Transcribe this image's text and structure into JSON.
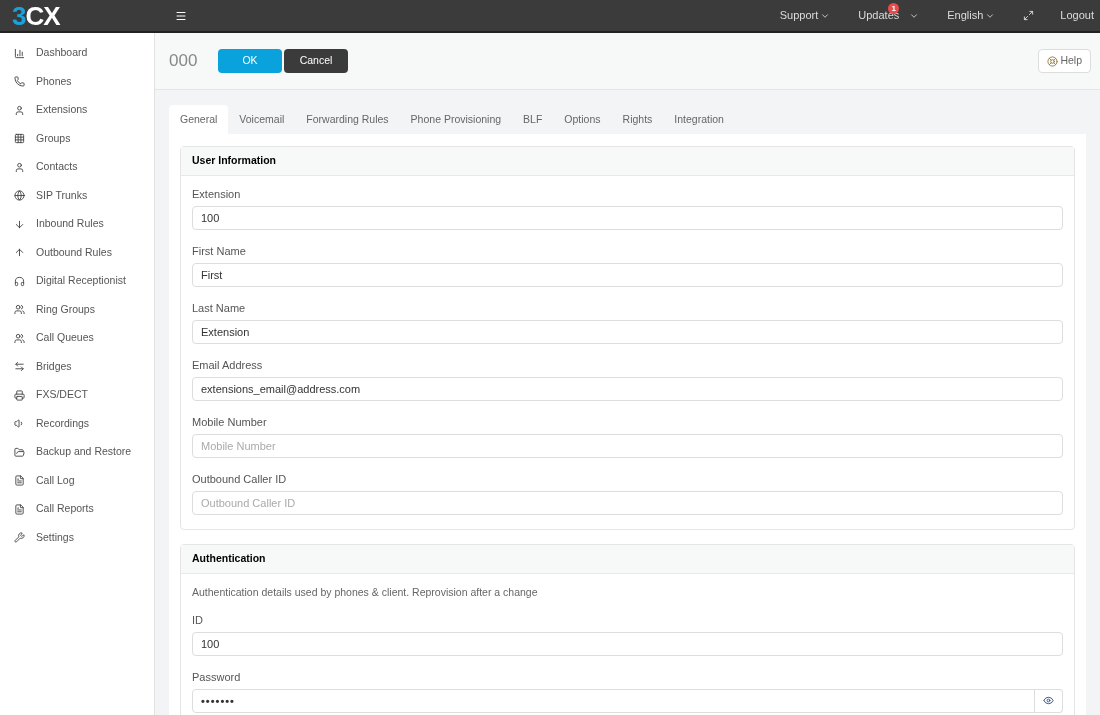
{
  "topbar": {
    "logo": {
      "accent": "3",
      "rest": "CX"
    },
    "menu": [
      {
        "label": "Support"
      },
      {
        "label": "Updates",
        "badge": "1"
      },
      {
        "label": "English"
      }
    ],
    "logout": "Logout"
  },
  "sidebar": {
    "items": [
      {
        "label": "Dashboard"
      },
      {
        "label": "Phones"
      },
      {
        "label": "Extensions"
      },
      {
        "label": "Groups"
      },
      {
        "label": "Contacts"
      },
      {
        "label": "SIP Trunks"
      },
      {
        "label": "Inbound Rules"
      },
      {
        "label": "Outbound Rules"
      },
      {
        "label": "Digital Receptionist"
      },
      {
        "label": "Ring Groups"
      },
      {
        "label": "Call Queues"
      },
      {
        "label": "Bridges"
      },
      {
        "label": "FXS/DECT"
      },
      {
        "label": "Recordings"
      },
      {
        "label": "Backup and Restore"
      },
      {
        "label": "Call Log"
      },
      {
        "label": "Call Reports"
      },
      {
        "label": "Settings"
      }
    ]
  },
  "header": {
    "title": "000",
    "ok": "OK",
    "cancel": "Cancel",
    "help": "Help"
  },
  "tabs": [
    {
      "label": "General",
      "selected": true
    },
    {
      "label": "Voicemail",
      "selected": false
    },
    {
      "label": "Forwarding Rules",
      "selected": false
    },
    {
      "label": "Phone Provisioning",
      "selected": false
    },
    {
      "label": "BLF",
      "selected": false
    },
    {
      "label": "Options",
      "selected": false
    },
    {
      "label": "Rights",
      "selected": false
    },
    {
      "label": "Integration",
      "selected": false
    }
  ],
  "sections": [
    {
      "title": "User Information",
      "fields": [
        {
          "label": "Extension",
          "value": "100"
        },
        {
          "label": "First Name",
          "value": "First"
        },
        {
          "label": "Last Name",
          "value": "Extension"
        },
        {
          "label": "Email Address",
          "value": "extensions_email@address.com"
        },
        {
          "label": "Mobile Number",
          "placeholder": "Mobile Number"
        },
        {
          "label": "Outbound Caller ID",
          "placeholder": "Outbound Caller ID"
        }
      ]
    },
    {
      "title": "Authentication",
      "note": "Authentication details used by phones & client. Reprovision after a change",
      "fields": [
        {
          "label": "ID",
          "value": "100"
        },
        {
          "label": "Password",
          "value": "•••••••",
          "kind": "password"
        }
      ]
    }
  ]
}
